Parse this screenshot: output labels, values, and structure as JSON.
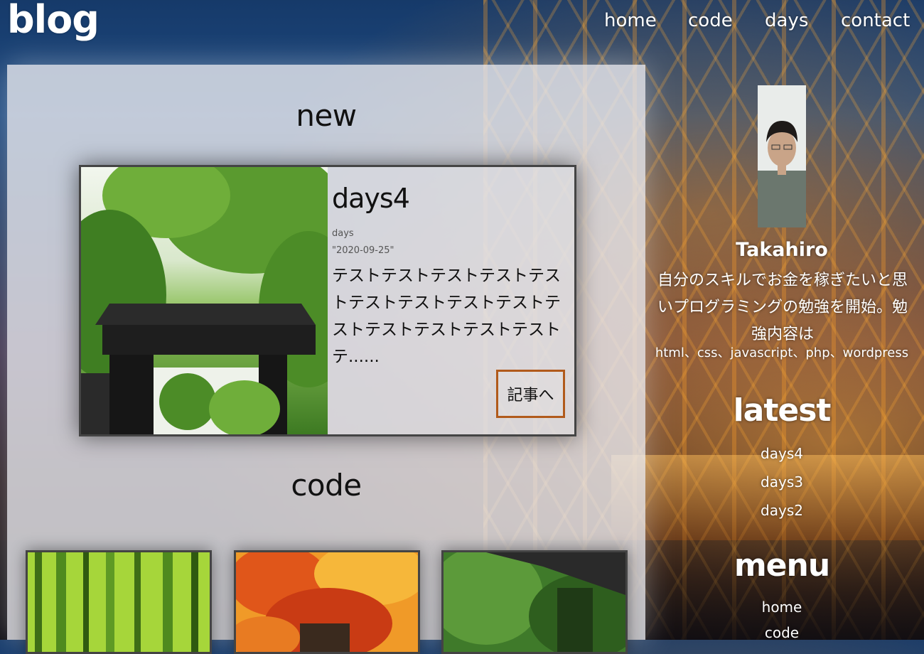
{
  "site": {
    "logo": "blog"
  },
  "nav": {
    "items": [
      "home",
      "code",
      "days",
      "contact"
    ]
  },
  "sections": {
    "new_title": "new",
    "code_title": "code"
  },
  "latest_post": {
    "title": "days4",
    "category": "days",
    "date": "\"2020-09-25\"",
    "excerpt": "テストテストテストテストテストテストテストテストテストテストテストテストテストテストテ......",
    "button_label": "記事へ"
  },
  "code_thumbs": [
    "bamboo-forest-image",
    "autumn-maple-image",
    "green-forest-image"
  ],
  "profile": {
    "name": "Takahiro",
    "bio": "自分のスキルでお金を稼ぎたいと思いプログラミングの勉強を開始。勉強内容は",
    "skills": "html、css、javascript、php、wordpress"
  },
  "sidebar": {
    "latest_heading": "latest",
    "latest_items": [
      "days4",
      "days3",
      "days2"
    ],
    "menu_heading": "menu",
    "menu_items": [
      "home",
      "code"
    ]
  },
  "colors": {
    "accent": "#b15a1b",
    "panel": "#ebebf0"
  }
}
